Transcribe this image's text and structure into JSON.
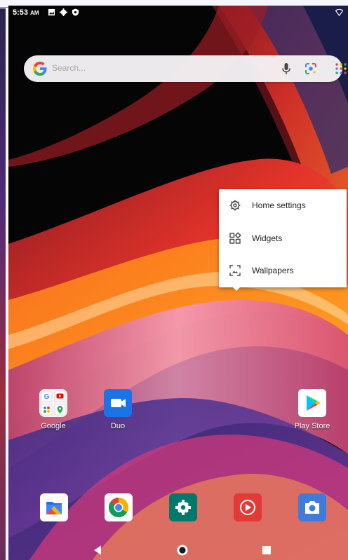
{
  "status_bar": {
    "time": "5:53",
    "ampm": "AM",
    "icons": [
      "image-icon",
      "gear-icon",
      "shield-icon",
      "wifi-icon"
    ]
  },
  "search_bar": {
    "placeholder": "Search...",
    "icons": [
      "google-g-icon",
      "mic-icon",
      "lens-icon",
      "apps-grid-icon"
    ]
  },
  "context_menu": {
    "items": [
      {
        "label": "Home settings",
        "icon": "gear-icon"
      },
      {
        "label": "Widgets",
        "icon": "widgets-icon"
      },
      {
        "label": "Wallpapers",
        "icon": "wallpaper-icon"
      }
    ]
  },
  "home_apps": [
    {
      "label": "Google",
      "icon": "google-folder-icon"
    },
    {
      "label": "Duo",
      "icon": "duo-icon"
    },
    {
      "label": "Play Store",
      "icon": "play-store-icon"
    }
  ],
  "dock_apps": [
    {
      "name": "Files",
      "icon": "files-icon"
    },
    {
      "name": "Chrome",
      "icon": "chrome-icon"
    },
    {
      "name": "Settings",
      "icon": "settings-icon"
    },
    {
      "name": "YouTube Music",
      "icon": "youtube-music-icon"
    },
    {
      "name": "Camera",
      "icon": "camera-icon"
    }
  ],
  "nav_bar": {
    "buttons": [
      "back",
      "home",
      "recents"
    ]
  },
  "colors": {
    "accent_blue": "#4285F4",
    "menu_bg": "#ffffff",
    "status_text": "#ffffff"
  }
}
